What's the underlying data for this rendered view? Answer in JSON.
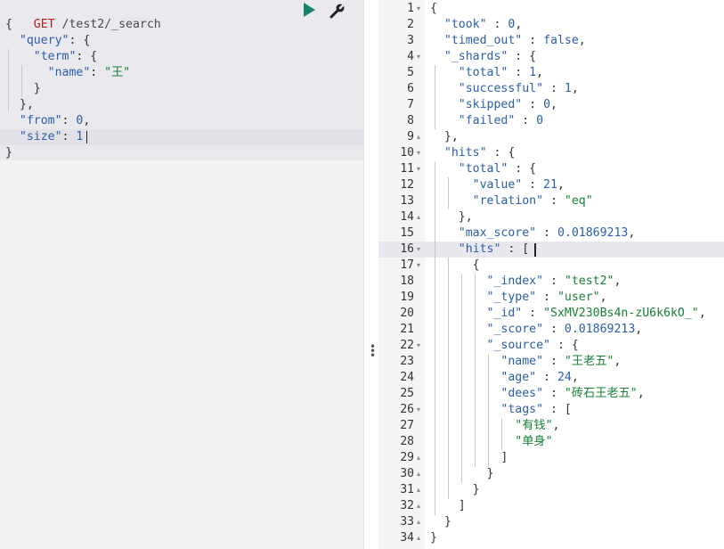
{
  "request": {
    "method": "GET",
    "path": "/test2/_search",
    "lines": [
      [
        [
          "punc",
          "{"
        ]
      ],
      [
        [
          "punc",
          "  "
        ],
        [
          "key",
          "\"query\""
        ],
        [
          "punc",
          ": {"
        ]
      ],
      [
        [
          "punc",
          "    "
        ],
        [
          "key",
          "\"term\""
        ],
        [
          "punc",
          ": {"
        ]
      ],
      [
        [
          "punc",
          "      "
        ],
        [
          "key",
          "\"name\""
        ],
        [
          "punc",
          ": "
        ],
        [
          "str",
          "\"王\""
        ]
      ],
      [
        [
          "punc",
          "    }"
        ]
      ],
      [
        [
          "punc",
          "  },"
        ]
      ],
      [
        [
          "punc",
          "  "
        ],
        [
          "key",
          "\"from\""
        ],
        [
          "punc",
          ": "
        ],
        [
          "num",
          "0"
        ],
        [
          "punc",
          ","
        ]
      ],
      [
        [
          "punc",
          "  "
        ],
        [
          "key",
          "\"size\""
        ],
        [
          "punc",
          ": "
        ],
        [
          "num",
          "1"
        ]
      ],
      [
        [
          "punc",
          "}"
        ]
      ]
    ]
  },
  "toolbar": {
    "play_icon": "play-icon",
    "wrench_icon": "wrench-icon"
  },
  "response": {
    "line_numbers": [
      "1",
      "2",
      "3",
      "4",
      "5",
      "6",
      "7",
      "8",
      "9",
      "10",
      "11",
      "12",
      "13",
      "14",
      "15",
      "16",
      "17",
      "18",
      "19",
      "20",
      "21",
      "22",
      "23",
      "24",
      "25",
      "26",
      "27",
      "28",
      "29",
      "30",
      "31",
      "32",
      "33",
      "34"
    ],
    "folds": [
      "▾",
      "",
      "",
      "▾",
      "",
      "",
      "",
      "",
      "▴",
      "▾",
      "▾",
      "",
      "",
      "▴",
      "",
      "▾",
      "▾",
      "",
      "",
      "",
      "",
      "▾",
      "",
      "",
      "",
      "▾",
      "",
      "",
      "▴",
      "▴",
      "▴",
      "▴",
      "▴",
      "▴"
    ],
    "lines": [
      [
        [
          "punc",
          "{"
        ]
      ],
      [
        [
          "punc",
          "  "
        ],
        [
          "key",
          "\"took\""
        ],
        [
          "punc",
          " : "
        ],
        [
          "num",
          "0"
        ],
        [
          "punc",
          ","
        ]
      ],
      [
        [
          "punc",
          "  "
        ],
        [
          "key",
          "\"timed_out\""
        ],
        [
          "punc",
          " : "
        ],
        [
          "bool",
          "false"
        ],
        [
          "punc",
          ","
        ]
      ],
      [
        [
          "punc",
          "  "
        ],
        [
          "key",
          "\"_shards\""
        ],
        [
          "punc",
          " : {"
        ]
      ],
      [
        [
          "punc",
          "    "
        ],
        [
          "key",
          "\"total\""
        ],
        [
          "punc",
          " : "
        ],
        [
          "num",
          "1"
        ],
        [
          "punc",
          ","
        ]
      ],
      [
        [
          "punc",
          "    "
        ],
        [
          "key",
          "\"successful\""
        ],
        [
          "punc",
          " : "
        ],
        [
          "num",
          "1"
        ],
        [
          "punc",
          ","
        ]
      ],
      [
        [
          "punc",
          "    "
        ],
        [
          "key",
          "\"skipped\""
        ],
        [
          "punc",
          " : "
        ],
        [
          "num",
          "0"
        ],
        [
          "punc",
          ","
        ]
      ],
      [
        [
          "punc",
          "    "
        ],
        [
          "key",
          "\"failed\""
        ],
        [
          "punc",
          " : "
        ],
        [
          "num",
          "0"
        ]
      ],
      [
        [
          "punc",
          "  },"
        ]
      ],
      [
        [
          "punc",
          "  "
        ],
        [
          "key",
          "\"hits\""
        ],
        [
          "punc",
          " : {"
        ]
      ],
      [
        [
          "punc",
          "    "
        ],
        [
          "key",
          "\"total\""
        ],
        [
          "punc",
          " : {"
        ]
      ],
      [
        [
          "punc",
          "      "
        ],
        [
          "key",
          "\"value\""
        ],
        [
          "punc",
          " : "
        ],
        [
          "num",
          "21"
        ],
        [
          "punc",
          ","
        ]
      ],
      [
        [
          "punc",
          "      "
        ],
        [
          "key",
          "\"relation\""
        ],
        [
          "punc",
          " : "
        ],
        [
          "str",
          "\"eq\""
        ]
      ],
      [
        [
          "punc",
          "    },"
        ]
      ],
      [
        [
          "punc",
          "    "
        ],
        [
          "key",
          "\"max_score\""
        ],
        [
          "punc",
          " : "
        ],
        [
          "num",
          "0.01869213"
        ],
        [
          "punc",
          ","
        ]
      ],
      [
        [
          "punc",
          "    "
        ],
        [
          "key",
          "\"hits\""
        ],
        [
          "punc",
          " : ["
        ]
      ],
      [
        [
          "punc",
          "      {"
        ]
      ],
      [
        [
          "punc",
          "        "
        ],
        [
          "key",
          "\"_index\""
        ],
        [
          "punc",
          " : "
        ],
        [
          "str",
          "\"test2\""
        ],
        [
          "punc",
          ","
        ]
      ],
      [
        [
          "punc",
          "        "
        ],
        [
          "key",
          "\"_type\""
        ],
        [
          "punc",
          " : "
        ],
        [
          "str",
          "\"user\""
        ],
        [
          "punc",
          ","
        ]
      ],
      [
        [
          "punc",
          "        "
        ],
        [
          "key",
          "\"_id\""
        ],
        [
          "punc",
          " : "
        ],
        [
          "str",
          "\"SxMV230Bs4n-zU6k6kO_\""
        ],
        [
          "punc",
          ","
        ]
      ],
      [
        [
          "punc",
          "        "
        ],
        [
          "key",
          "\"_score\""
        ],
        [
          "punc",
          " : "
        ],
        [
          "num",
          "0.01869213"
        ],
        [
          "punc",
          ","
        ]
      ],
      [
        [
          "punc",
          "        "
        ],
        [
          "key",
          "\"_source\""
        ],
        [
          "punc",
          " : {"
        ]
      ],
      [
        [
          "punc",
          "          "
        ],
        [
          "key",
          "\"name\""
        ],
        [
          "punc",
          " : "
        ],
        [
          "str",
          "\"王老五\""
        ],
        [
          "punc",
          ","
        ]
      ],
      [
        [
          "punc",
          "          "
        ],
        [
          "key",
          "\"age\""
        ],
        [
          "punc",
          " : "
        ],
        [
          "num",
          "24"
        ],
        [
          "punc",
          ","
        ]
      ],
      [
        [
          "punc",
          "          "
        ],
        [
          "key",
          "\"dees\""
        ],
        [
          "punc",
          " : "
        ],
        [
          "str",
          "\"砖石王老五\""
        ],
        [
          "punc",
          ","
        ]
      ],
      [
        [
          "punc",
          "          "
        ],
        [
          "key",
          "\"tags\""
        ],
        [
          "punc",
          " : ["
        ]
      ],
      [
        [
          "punc",
          "            "
        ],
        [
          "str",
          "\"有钱\""
        ],
        [
          "punc",
          ","
        ]
      ],
      [
        [
          "punc",
          "            "
        ],
        [
          "str",
          "\"单身\""
        ]
      ],
      [
        [
          "punc",
          "          ]"
        ]
      ],
      [
        [
          "punc",
          "        }"
        ]
      ],
      [
        [
          "punc",
          "      }"
        ]
      ],
      [
        [
          "punc",
          "    ]"
        ]
      ],
      [
        [
          "punc",
          "  }"
        ]
      ],
      [
        [
          "punc",
          "}"
        ]
      ]
    ]
  }
}
